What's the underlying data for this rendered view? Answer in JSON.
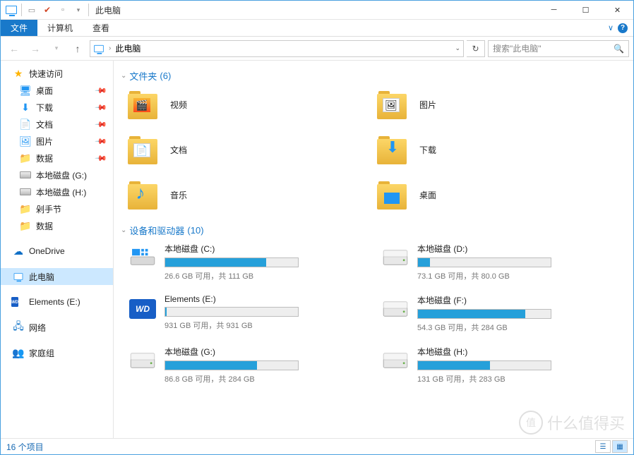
{
  "window": {
    "title": "此电脑"
  },
  "qat": {
    "item1": "▢",
    "item2": "✔",
    "item3": "▫"
  },
  "ribbon": {
    "file": "文件",
    "computer": "计算机",
    "view": "查看",
    "expand_tip": "∨"
  },
  "nav": {
    "address": "此电脑",
    "search_placeholder": "搜索\"此电脑\""
  },
  "sidebar": {
    "quick": "快速访问",
    "quick_items": [
      {
        "label": "桌面",
        "icon": "desktop"
      },
      {
        "label": "下载",
        "icon": "download"
      },
      {
        "label": "文档",
        "icon": "document"
      },
      {
        "label": "图片",
        "icon": "picture"
      },
      {
        "label": "数据",
        "icon": "folder"
      },
      {
        "label": "本地磁盘 (G:)",
        "icon": "drive"
      },
      {
        "label": "本地磁盘 (H:)",
        "icon": "drive"
      },
      {
        "label": "剁手节",
        "icon": "folder"
      },
      {
        "label": "数据",
        "icon": "folder"
      }
    ],
    "onedrive": "OneDrive",
    "thispc": "此电脑",
    "elements": "Elements (E:)",
    "network": "网络",
    "homegroup": "家庭组"
  },
  "groups": {
    "folders": {
      "label": "文件夹",
      "count": "(6)"
    },
    "devices": {
      "label": "设备和驱动器",
      "count": "(10)"
    }
  },
  "folders": [
    {
      "label": "视频",
      "kind": "video"
    },
    {
      "label": "图片",
      "kind": "picture"
    },
    {
      "label": "文档",
      "kind": "document"
    },
    {
      "label": "下载",
      "kind": "download"
    },
    {
      "label": "音乐",
      "kind": "music"
    },
    {
      "label": "桌面",
      "kind": "desktop"
    }
  ],
  "drives": [
    {
      "name": "本地磁盘 (C:)",
      "stats": "26.6 GB 可用，共 111 GB",
      "fill": 76,
      "icon": "win"
    },
    {
      "name": "本地磁盘 (D:)",
      "stats": "73.1 GB 可用，共 80.0 GB",
      "fill": 9,
      "icon": "hdd"
    },
    {
      "name": "Elements (E:)",
      "stats": "931 GB 可用，共 931 GB",
      "fill": 1,
      "icon": "wd"
    },
    {
      "name": "本地磁盘 (F:)",
      "stats": "54.3 GB 可用，共 284 GB",
      "fill": 81,
      "icon": "hdd"
    },
    {
      "name": "本地磁盘 (G:)",
      "stats": "86.8 GB 可用，共 284 GB",
      "fill": 69,
      "icon": "hdd"
    },
    {
      "name": "本地磁盘 (H:)",
      "stats": "131 GB 可用，共 283 GB",
      "fill": 54,
      "icon": "hdd"
    }
  ],
  "statusbar": {
    "count": "16 个项目"
  },
  "watermark": {
    "text": "什么值得买",
    "badge": "值"
  }
}
